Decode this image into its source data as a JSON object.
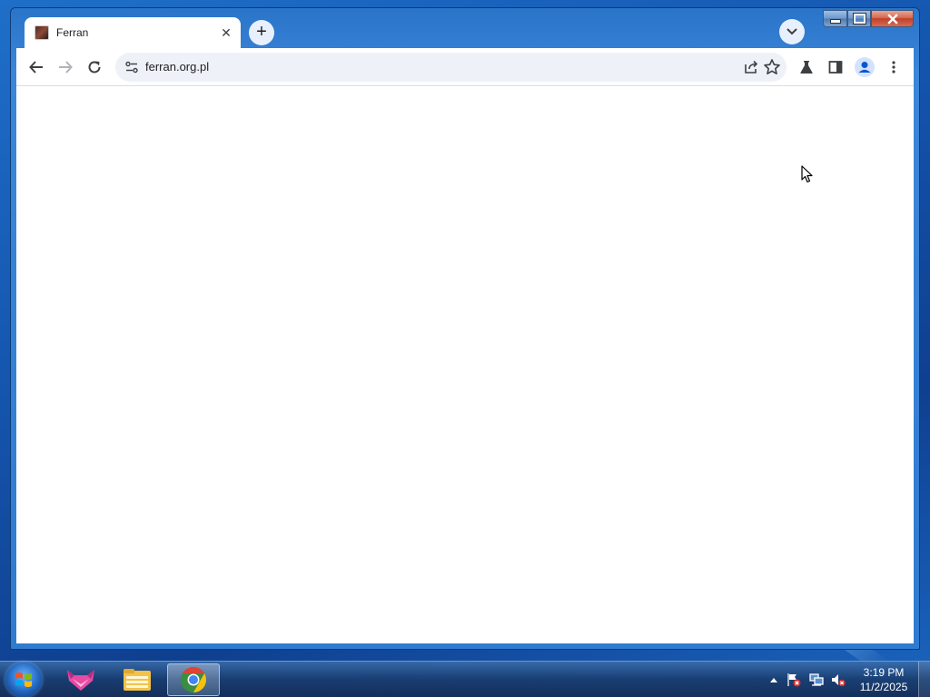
{
  "browser": {
    "tab": {
      "title": "Ferran",
      "close_glyph": "✕"
    },
    "new_tab_glyph": "+",
    "address": {
      "url": "ferran.org.pl"
    }
  },
  "taskbar": {
    "apps": [
      "start-orb",
      "pink-fox-app",
      "file-explorer",
      "chrome"
    ],
    "clock": {
      "time": "3:19 PM",
      "date": "11/2/2025"
    }
  },
  "colors": {
    "tab_bg": "#ffffff",
    "omnibox_bg": "#eef2f8",
    "title_bar": "#2f7bd0"
  }
}
